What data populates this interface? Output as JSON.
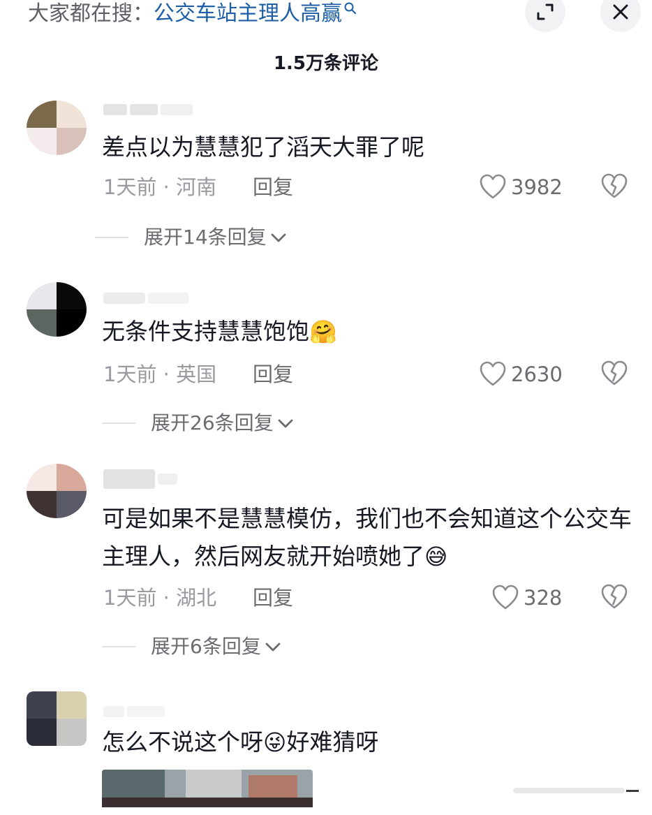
{
  "search": {
    "prefix": "大家都在搜：",
    "term": "公交车站主理人高赢"
  },
  "header": {
    "title": "1.5万条评论"
  },
  "comments": [
    {
      "text": "差点以为慧慧犯了滔天大罪了呢",
      "emoji": "",
      "time": "1天前",
      "location": "河南",
      "reply_label": "回复",
      "likes": "3982",
      "expand_label": "展开14条回复"
    },
    {
      "text": "无条件支持慧慧饱饱",
      "emoji": "🤗",
      "time": "1天前",
      "location": "英国",
      "reply_label": "回复",
      "likes": "2630",
      "expand_label": "展开26条回复"
    },
    {
      "text": "可是如果不是慧慧模仿，我们也不会知道这个公交车主理人，然后网友就开始喷她了",
      "emoji": "😅",
      "time": "1天前",
      "location": "湖北",
      "reply_label": "回复",
      "likes": "328",
      "expand_label": "展开6条回复"
    },
    {
      "text": "怎么不说这个呀",
      "emoji": "😜",
      "text_after": "好难猜呀"
    }
  ],
  "icons": {
    "search": "magnifier-icon",
    "expand": "expand-icon",
    "close": "close-icon",
    "like": "heart-icon",
    "dislike": "broken-heart-icon",
    "chevron": "chevron-down-icon"
  },
  "colors": {
    "search_term": "#1f5fa6",
    "meta": "#9a9aa0",
    "text": "#161823"
  }
}
